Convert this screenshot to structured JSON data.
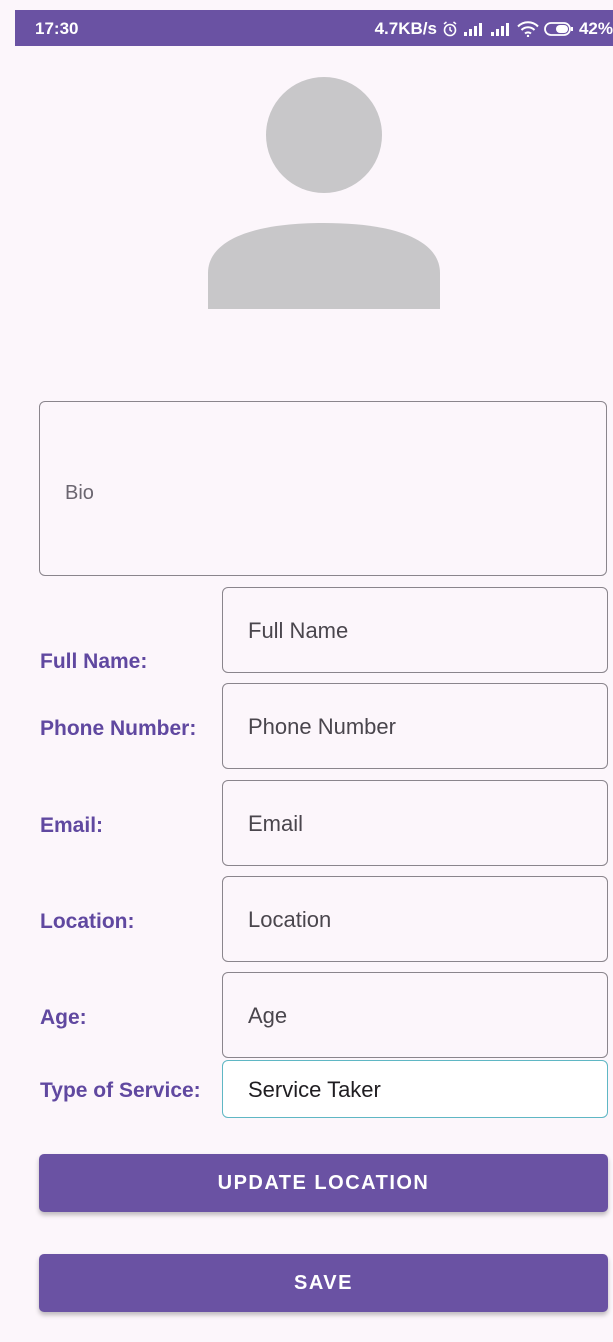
{
  "status_bar": {
    "time": "17:30",
    "network_speed": "4.7KB/s",
    "battery": "42%",
    "icons": [
      "alarm-icon",
      "signal-icon",
      "signal-icon",
      "wifi-icon",
      "battery-icon"
    ]
  },
  "profile": {
    "avatar_icon": "person-placeholder-icon"
  },
  "bio": {
    "placeholder": "Bio"
  },
  "form": {
    "full_name": {
      "label": "Full Name:",
      "placeholder": "Full Name"
    },
    "phone": {
      "label": "Phone Number:",
      "placeholder": "Phone Number"
    },
    "email": {
      "label": "Email:",
      "placeholder": "Email"
    },
    "location": {
      "label": "Location:",
      "placeholder": "Location"
    },
    "age": {
      "label": "Age:",
      "placeholder": "Age"
    },
    "service": {
      "label": "Type of Service:",
      "value": "Service Taker"
    }
  },
  "buttons": {
    "update_location": "UPDATE LOCATION",
    "save": "SAVE"
  },
  "colors": {
    "primary": "#6a52a3",
    "label": "#6048a0",
    "background": "#fcf6fb",
    "focus_border": "#5fb7c4"
  }
}
